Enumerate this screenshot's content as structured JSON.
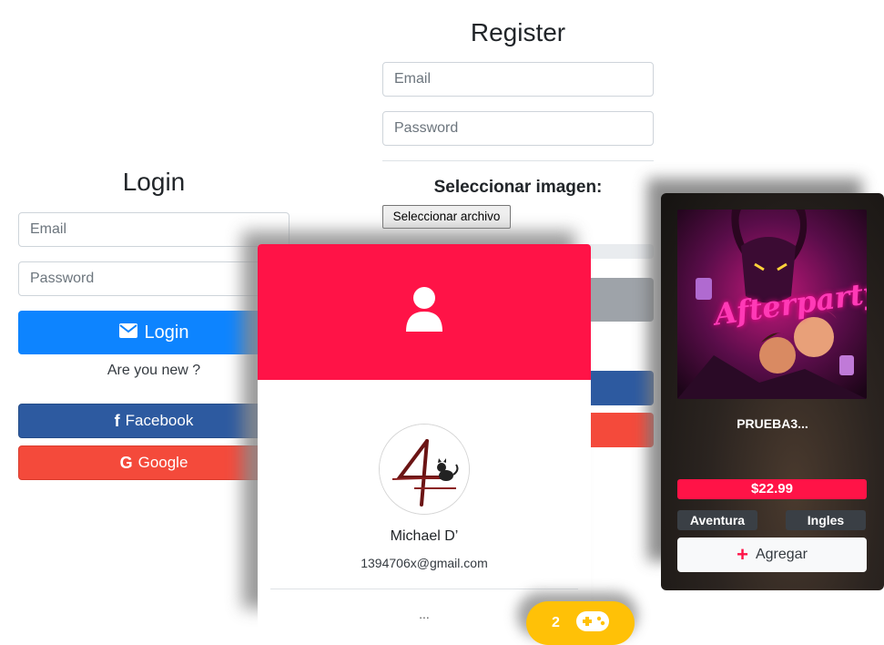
{
  "login": {
    "title": "Login",
    "email_placeholder": "Email",
    "password_placeholder": "Password",
    "submit_label": "Login",
    "new_user_text": "Are you new ?",
    "facebook_label": "Facebook",
    "google_label": "Google"
  },
  "register": {
    "title": "Register",
    "email_placeholder": "Email",
    "password_placeholder": "Password",
    "image_label": "Seleccionar imagen:",
    "file_button_label": "Seleccionar archivo"
  },
  "profile": {
    "name": "Michael D’",
    "email": "1394706x@gmail.com",
    "more": "..."
  },
  "game": {
    "cover_title": "Afterparty",
    "title": "PRUEBA3...",
    "price": "$22.99",
    "genre": "Aventura",
    "language": "Ingles",
    "add_label": "Agregar"
  },
  "cart": {
    "count": "2"
  },
  "colors": {
    "primary": "#0d84ff",
    "accent": "#ff1347",
    "facebook": "#2d5aa0",
    "google": "#f44a3b",
    "cart": "#ffc107"
  },
  "icons": {
    "login": "envelope-icon",
    "facebook": "facebook-icon",
    "google": "google-icon",
    "profile": "user-icon",
    "add": "plus-icon",
    "cart": "gamepad-icon"
  }
}
